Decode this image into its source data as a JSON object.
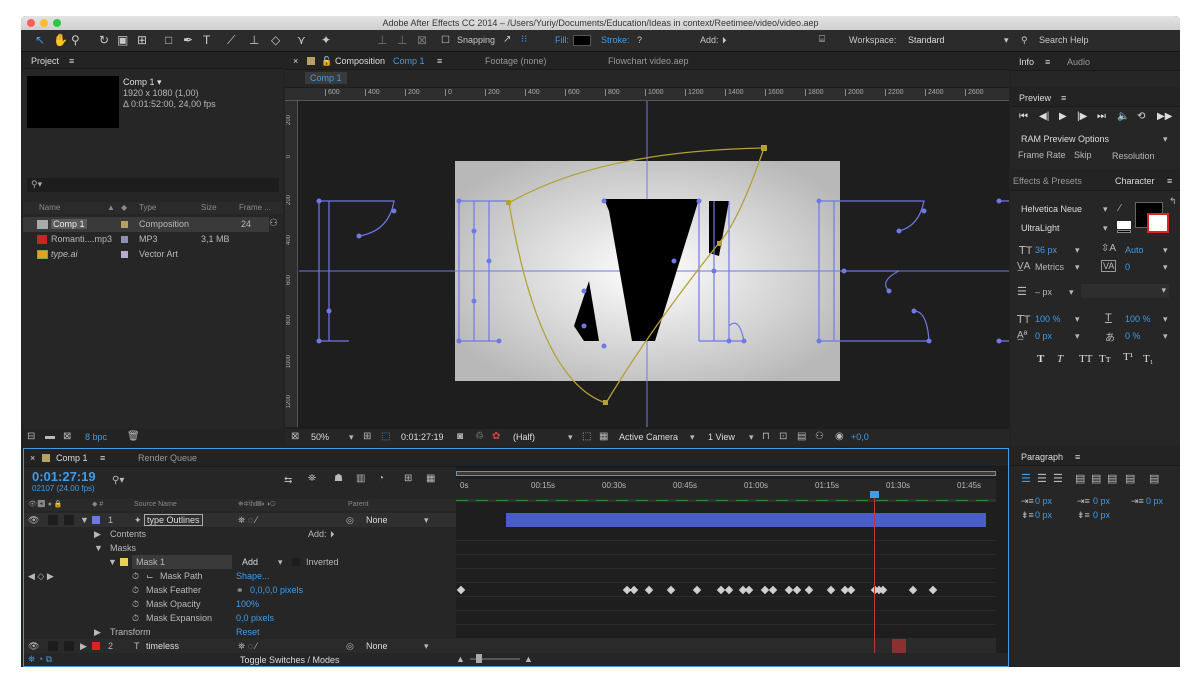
{
  "window": {
    "title": "Adobe After Effects CC 2014 – /Users/Yuriy/Documents/Education/Ideas in context/Reetimee/video/video.aep"
  },
  "toolbar": {
    "snapping": "Snapping",
    "fill": "Fill:",
    "stroke": "Stroke:",
    "stroke_value": "?",
    "add": "Add:",
    "workspace_label": "Workspace:",
    "workspace_value": "Standard",
    "search_help": "Search Help"
  },
  "project": {
    "title": "Project",
    "comp_name": "Comp 1 ▾",
    "comp_size": "1920 x 1080 (1,00)",
    "comp_dur": "Δ 0:01:52:00, 24,00 fps",
    "columns": {
      "name": "Name",
      "type": "Type",
      "size": "Size",
      "frame": "Frame ..."
    },
    "items": [
      {
        "name": "Comp 1",
        "type": "Composition",
        "size": "",
        "frame": "24"
      },
      {
        "name": "Romanti....mp3",
        "type": "MP3",
        "size": "3,1 MB",
        "frame": ""
      },
      {
        "name": "type.ai",
        "type": "Vector Art",
        "size": "",
        "frame": ""
      }
    ],
    "bpc": "8 bpc"
  },
  "comp_panel": {
    "tab_composition": "Composition",
    "tab_comp_name": "Comp 1",
    "tab_footage": "Footage (none)",
    "tab_flowchart": "Flowchart video.aep",
    "subtab": "Comp 1",
    "ruler": [
      "600",
      "400",
      "200",
      "0",
      "200",
      "400",
      "600",
      "800",
      "1000",
      "1200",
      "1400",
      "1600",
      "1800",
      "2000",
      "2200",
      "2400",
      "2600"
    ],
    "vruler": [
      "200",
      "0",
      "200",
      "400",
      "600",
      "800",
      "1000",
      "1200"
    ],
    "zoom": "50%",
    "timecode": "0:01:27:19",
    "resolution": "(Half)",
    "camera": "Active Camera",
    "views": "1 View",
    "exposure": "+0,0"
  },
  "info_panel": {
    "tab_info": "Info",
    "tab_audio": "Audio"
  },
  "preview_panel": {
    "title": "Preview",
    "ram_options": "RAM Preview Options",
    "frame_rate": "Frame Rate",
    "skip": "Skip",
    "resolution": "Resolution"
  },
  "character": {
    "tab_effects": "Effects & Presets",
    "tab_character": "Character",
    "font": "Helvetica Neue",
    "style": "UltraLight",
    "size": "36 px",
    "leading": "Auto",
    "kerning": "Metrics",
    "tracking": "0",
    "stroke_width": "– px",
    "vscale": "100 %",
    "hscale": "100 %",
    "baseline": "0 px",
    "tsume": "0 %"
  },
  "paragraph": {
    "title": "Paragraph",
    "indent_left": "0 px",
    "indent_first": "0 px",
    "indent_right": "0 px",
    "space_before": "0 px",
    "space_after": "0 px"
  },
  "timeline": {
    "tab_comp": "Comp 1",
    "tab_render": "Render Queue",
    "timecode": "0:01:27:19",
    "frames": "02107 (24.00 fps)",
    "col_source": "Source Name",
    "col_parent": "Parent",
    "ticks": [
      "0s",
      "00:15s",
      "00:30s",
      "00:45s",
      "01:00s",
      "01:15s",
      "01:30s",
      "01:45s"
    ],
    "layer1": {
      "num": "1",
      "name": "type Outlines",
      "parent": "None"
    },
    "contents": "Contents",
    "contents_add": "Add:",
    "masks": "Masks",
    "mask1": "Mask 1",
    "mask_mode": "Add",
    "inverted": "Inverted",
    "props": [
      {
        "name": "Mask Path",
        "value": "Shape..."
      },
      {
        "name": "Mask Feather",
        "value": "0,0,0,0 pixels"
      },
      {
        "name": "Mask Opacity",
        "value": "100%"
      },
      {
        "name": "Mask Expansion",
        "value": "0,0 pixels"
      }
    ],
    "transform": "Transform",
    "transform_value": "Reset",
    "layer2": {
      "num": "2",
      "name": "timeless",
      "parent": "None"
    },
    "toggle": "Toggle Switches / Modes"
  },
  "colors": {
    "accent": "#3f9ce8",
    "mask_yellow": "#b5a136",
    "path_blue": "#6f79e6",
    "playhead_red": "#c33"
  }
}
